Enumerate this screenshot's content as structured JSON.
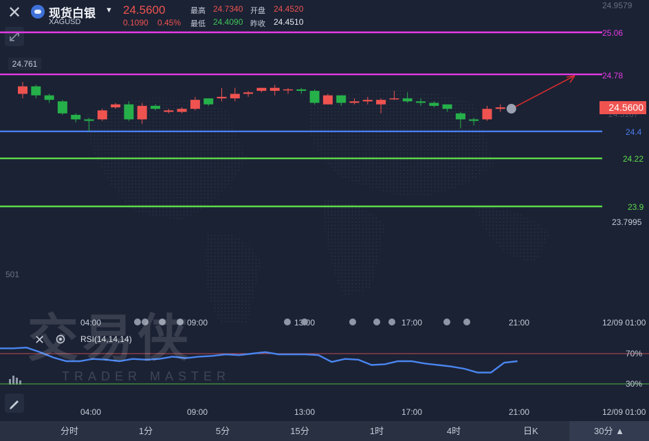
{
  "header": {
    "instrument_name": "现货白银",
    "symbol": "XAGUSD",
    "last_price": "24.5600",
    "change": "0.1090",
    "change_pct": "0.45%",
    "stats": {
      "high_label": "最高",
      "high_value": "24.7340",
      "open_label": "开盘",
      "open_value": "24.4520",
      "low_label": "最低",
      "low_value": "24.4090",
      "prev_close_label": "昨收",
      "prev_close_value": "24.4510"
    }
  },
  "price_axis": {
    "top_partial": "24.9579",
    "price_label_left": "24.761",
    "low_label": "23.7995",
    "mid_partial": "24.5167",
    "left_partial": "501",
    "current_price_tag": "24.5600"
  },
  "levels": [
    {
      "value": "25.06",
      "color": "#e63ae6"
    },
    {
      "value": "24.78",
      "color": "#e63ae6"
    },
    {
      "value": "24.4",
      "color": "#4a7ff0"
    },
    {
      "value": "24.22",
      "color": "#5ddc4a"
    },
    {
      "value": "23.9",
      "color": "#5ddc4a"
    }
  ],
  "time_axis_main": [
    "04:00",
    "09:00",
    "13:00",
    "17:00",
    "21:00",
    "12/09 01:00"
  ],
  "time_axis_rsi": [
    "04:00",
    "09:00",
    "13:00",
    "17:00",
    "21:00",
    "12/09 01:00"
  ],
  "rsi": {
    "label": "RSI(14,14,14)",
    "level_high": "70%",
    "level_low": "30%",
    "values": [
      77,
      77,
      78,
      72,
      65,
      60,
      60,
      63,
      62,
      60,
      63,
      62,
      63,
      66,
      64,
      66,
      67,
      69,
      68,
      70,
      72,
      69,
      69,
      69,
      68,
      59,
      63,
      62,
      55,
      56,
      60,
      60,
      57,
      55,
      53,
      50,
      45,
      45,
      58,
      60
    ]
  },
  "bottom_tabs": [
    {
      "label": "分时",
      "selected": false
    },
    {
      "label": "1分",
      "selected": false
    },
    {
      "label": "5分",
      "selected": false
    },
    {
      "label": "15分",
      "selected": false
    },
    {
      "label": "1时",
      "selected": false
    },
    {
      "label": "4时",
      "selected": false
    },
    {
      "label": "日K",
      "selected": false
    },
    {
      "label": "30分",
      "selected": true
    }
  ],
  "watermark": {
    "text": "交易侠",
    "subtext": "TRADER MASTER"
  },
  "colors": {
    "up": "#ef5350",
    "down": "#26b04a",
    "rsi_line": "#4a86f0"
  },
  "candles": [
    {
      "o": 24.65,
      "c": 24.7,
      "h": 24.73,
      "l": 24.62
    },
    {
      "o": 24.7,
      "c": 24.64,
      "h": 24.71,
      "l": 24.62
    },
    {
      "o": 24.64,
      "c": 24.61,
      "h": 24.65,
      "l": 24.59
    },
    {
      "o": 24.6,
      "c": 24.52,
      "h": 24.61,
      "l": 24.51
    },
    {
      "o": 24.51,
      "c": 24.48,
      "h": 24.52,
      "l": 24.46
    },
    {
      "o": 24.48,
      "c": 24.47,
      "h": 24.49,
      "l": 24.4
    },
    {
      "o": 24.48,
      "c": 24.54,
      "h": 24.55,
      "l": 24.47
    },
    {
      "o": 24.56,
      "c": 24.58,
      "h": 24.59,
      "l": 24.55
    },
    {
      "o": 24.58,
      "c": 24.48,
      "h": 24.6,
      "l": 24.47
    },
    {
      "o": 24.48,
      "c": 24.57,
      "h": 24.59,
      "l": 24.45
    },
    {
      "o": 24.57,
      "c": 24.55,
      "h": 24.58,
      "l": 24.54
    },
    {
      "o": 24.53,
      "c": 24.54,
      "h": 24.55,
      "l": 24.52
    },
    {
      "o": 24.53,
      "c": 24.55,
      "h": 24.56,
      "l": 24.52
    },
    {
      "o": 24.55,
      "c": 24.61,
      "h": 24.63,
      "l": 24.54
    },
    {
      "o": 24.62,
      "c": 24.58,
      "h": 24.62,
      "l": 24.57
    },
    {
      "o": 24.62,
      "c": 24.63,
      "h": 24.69,
      "l": 24.6
    },
    {
      "o": 24.62,
      "c": 24.65,
      "h": 24.69,
      "l": 24.6
    },
    {
      "o": 24.65,
      "c": 24.66,
      "h": 24.67,
      "l": 24.63
    },
    {
      "o": 24.67,
      "c": 24.69,
      "h": 24.69,
      "l": 24.66
    },
    {
      "o": 24.67,
      "c": 24.69,
      "h": 24.71,
      "l": 24.64
    },
    {
      "o": 24.68,
      "c": 24.68,
      "h": 24.69,
      "l": 24.65
    },
    {
      "o": 24.68,
      "c": 24.67,
      "h": 24.69,
      "l": 24.65
    },
    {
      "o": 24.67,
      "c": 24.59,
      "h": 24.68,
      "l": 24.58
    },
    {
      "o": 24.58,
      "c": 24.64,
      "h": 24.65,
      "l": 24.58
    },
    {
      "o": 24.64,
      "c": 24.59,
      "h": 24.64,
      "l": 24.57
    },
    {
      "o": 24.59,
      "c": 24.6,
      "h": 24.62,
      "l": 24.58
    },
    {
      "o": 24.6,
      "c": 24.61,
      "h": 24.63,
      "l": 24.58
    },
    {
      "o": 24.58,
      "c": 24.61,
      "h": 24.62,
      "l": 24.52
    },
    {
      "o": 24.62,
      "c": 24.62,
      "h": 24.67,
      "l": 24.61
    },
    {
      "o": 24.62,
      "c": 24.6,
      "h": 24.66,
      "l": 24.59
    },
    {
      "o": 24.6,
      "c": 24.59,
      "h": 24.62,
      "l": 24.57
    },
    {
      "o": 24.59,
      "c": 24.57,
      "h": 24.6,
      "l": 24.56
    },
    {
      "o": 24.58,
      "c": 24.55,
      "h": 24.58,
      "l": 24.53
    },
    {
      "o": 24.52,
      "c": 24.48,
      "h": 24.53,
      "l": 24.42
    },
    {
      "o": 24.48,
      "c": 24.47,
      "h": 24.49,
      "l": 24.44
    },
    {
      "o": 24.48,
      "c": 24.55,
      "h": 24.57,
      "l": 24.47
    },
    {
      "o": 24.55,
      "c": 24.56,
      "h": 24.58,
      "l": 24.53
    }
  ]
}
